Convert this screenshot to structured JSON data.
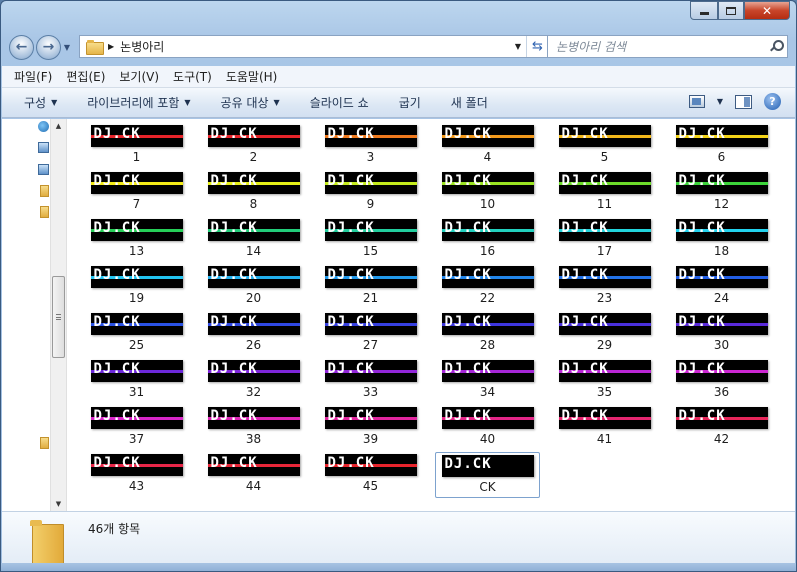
{
  "window": {
    "caption_buttons": [
      "minimize",
      "maximize",
      "close"
    ]
  },
  "address": {
    "crumb": "논병아리",
    "search_placeholder": "논병아리 검색"
  },
  "menu": [
    "파일(F)",
    "편집(E)",
    "보기(V)",
    "도구(T)",
    "도움말(H)"
  ],
  "commands": [
    {
      "label": "구성",
      "has_dropdown": true
    },
    {
      "label": "라이브러리에 포함",
      "has_dropdown": true
    },
    {
      "label": "공유 대상",
      "has_dropdown": true
    },
    {
      "label": "슬라이드 쇼",
      "has_dropdown": false
    },
    {
      "label": "굽기",
      "has_dropdown": false
    },
    {
      "label": "새 폴더",
      "has_dropdown": false
    }
  ],
  "thumbnail_text": "DJ.CK",
  "files": [
    {
      "name": "1",
      "stripe": "#e8242a"
    },
    {
      "name": "2",
      "stripe": "#e8242a"
    },
    {
      "name": "3",
      "stripe": "#f07a1e"
    },
    {
      "name": "4",
      "stripe": "#f39a1c"
    },
    {
      "name": "5",
      "stripe": "#f3b81a"
    },
    {
      "name": "6",
      "stripe": "#f4d418"
    },
    {
      "name": "7",
      "stripe": "#f4ec18"
    },
    {
      "name": "8",
      "stripe": "#e6f018"
    },
    {
      "name": "9",
      "stripe": "#c5ec1c"
    },
    {
      "name": "10",
      "stripe": "#9be422"
    },
    {
      "name": "11",
      "stripe": "#6ddc2a"
    },
    {
      "name": "12",
      "stripe": "#3cd43a"
    },
    {
      "name": "13",
      "stripe": "#26cf58"
    },
    {
      "name": "14",
      "stripe": "#22cd7a"
    },
    {
      "name": "15",
      "stripe": "#22ce9e"
    },
    {
      "name": "16",
      "stripe": "#22d0be"
    },
    {
      "name": "17",
      "stripe": "#22d4dc"
    },
    {
      "name": "18",
      "stripe": "#22d2ee"
    },
    {
      "name": "19",
      "stripe": "#22c4f0"
    },
    {
      "name": "20",
      "stripe": "#22b0ee"
    },
    {
      "name": "21",
      "stripe": "#229aec"
    },
    {
      "name": "22",
      "stripe": "#2286ea"
    },
    {
      "name": "23",
      "stripe": "#2272e8"
    },
    {
      "name": "24",
      "stripe": "#225ee6"
    },
    {
      "name": "25",
      "stripe": "#2a52e4"
    },
    {
      "name": "26",
      "stripe": "#2f48e2"
    },
    {
      "name": "27",
      "stripe": "#3640e0"
    },
    {
      "name": "28",
      "stripe": "#3e36de"
    },
    {
      "name": "29",
      "stripe": "#4a30dc"
    },
    {
      "name": "30",
      "stripe": "#5a2ada"
    },
    {
      "name": "31",
      "stripe": "#6c28da"
    },
    {
      "name": "32",
      "stripe": "#7e26da"
    },
    {
      "name": "33",
      "stripe": "#9226da"
    },
    {
      "name": "34",
      "stripe": "#a626d8"
    },
    {
      "name": "35",
      "stripe": "#ba26d6"
    },
    {
      "name": "36",
      "stripe": "#cc26d2"
    },
    {
      "name": "37",
      "stripe": "#d826c8"
    },
    {
      "name": "38",
      "stripe": "#de26b6"
    },
    {
      "name": "39",
      "stripe": "#e226a0"
    },
    {
      "name": "40",
      "stripe": "#e42688"
    },
    {
      "name": "41",
      "stripe": "#e62670"
    },
    {
      "name": "42",
      "stripe": "#e8265a"
    },
    {
      "name": "43",
      "stripe": "#e82648"
    },
    {
      "name": "44",
      "stripe": "#e82638"
    },
    {
      "name": "45",
      "stripe": "#e8242c"
    },
    {
      "name": "CK",
      "stripe": "",
      "selected": true
    }
  ],
  "details": {
    "item_count": "46개 항목"
  },
  "colors": {
    "accent": "#2f62b0",
    "selection_border": "#7da2ce"
  }
}
